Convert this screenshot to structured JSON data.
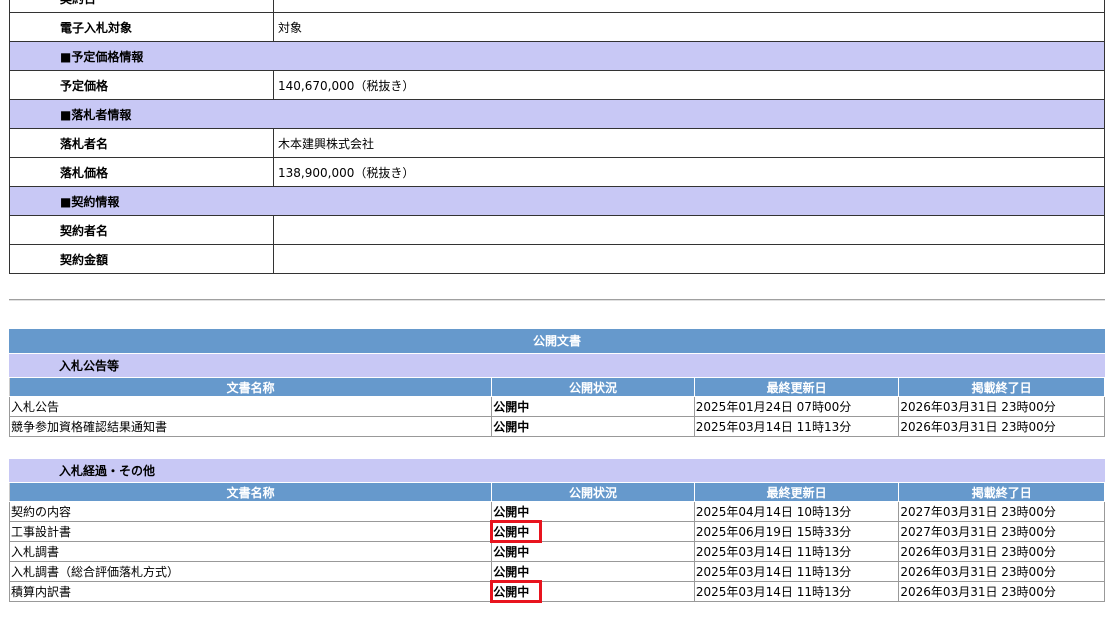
{
  "info": {
    "partial_label": "契約日",
    "electronic_bid_label": "電子入札対象",
    "electronic_bid_value": "対象",
    "section_planned_price": "■予定価格情報",
    "planned_price_label": "予定価格",
    "planned_price_value": "140,670,000（税抜き）",
    "section_winner": "■落札者情報",
    "winner_name_label": "落札者名",
    "winner_name_value": "木本建興株式会社",
    "winning_price_label": "落札価格",
    "winning_price_value": "138,900,000（税抜き）",
    "section_contract": "■契約情報",
    "contractor_label": "契約者名",
    "contractor_value": "",
    "contract_amount_label": "契約金額",
    "contract_amount_value": ""
  },
  "public_docs": {
    "title": "公開文書",
    "headers": [
      "文書名称",
      "公開状況",
      "最終更新日",
      "掲載終了日"
    ],
    "group1": {
      "title": "入札公告等",
      "rows": [
        {
          "name": "入札公告",
          "status": "公開中",
          "updated": "2025年01月24日 07時00分",
          "end": "2026年03月31日 23時00分"
        },
        {
          "name": "競争参加資格確認結果通知書",
          "status": "公開中",
          "updated": "2025年03月14日 11時13分",
          "end": "2026年03月31日 23時00分"
        }
      ]
    },
    "group2": {
      "title": "入札経過・その他",
      "rows": [
        {
          "name": "契約の内容",
          "status": "公開中",
          "updated": "2025年04月14日 10時13分",
          "end": "2027年03月31日 23時00分"
        },
        {
          "name": "工事設計書",
          "status": "公開中",
          "updated": "2025年06月19日 15時33分",
          "end": "2027年03月31日 23時00分"
        },
        {
          "name": "入札調書",
          "status": "公開中",
          "updated": "2025年03月14日 11時13分",
          "end": "2026年03月31日 23時00分"
        },
        {
          "name": "入札調書（総合評価落札方式）",
          "status": "公開中",
          "updated": "2025年03月14日 11時13分",
          "end": "2026年03月31日 23時00分"
        },
        {
          "name": "積算内訳書",
          "status": "公開中",
          "updated": "2025年03月14日 11時13分",
          "end": "2026年03月31日 23時00分"
        }
      ]
    }
  },
  "colors": {
    "header_blue": "#6699cc",
    "section_lavender": "#c8c8f5",
    "highlight_red": "#e8141e"
  }
}
